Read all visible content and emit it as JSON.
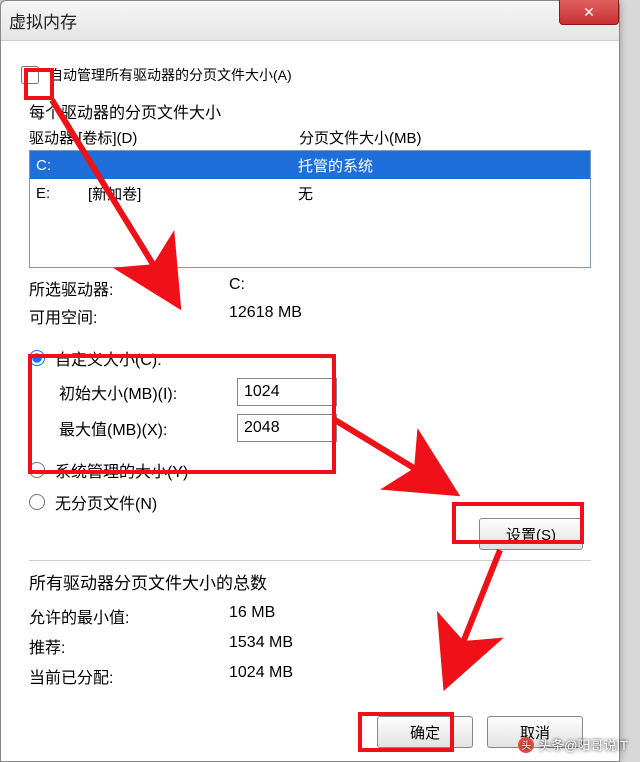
{
  "window": {
    "title": "虚拟内存"
  },
  "auto_manage": {
    "label": "自动管理所有驱动器的分页文件大小(A)",
    "checked": false
  },
  "per_drive_label": "每个驱动器的分页文件大小",
  "col_drive": "驱动器 [卷标](D)",
  "col_paging": "分页文件大小(MB)",
  "drives": [
    {
      "letter": "C:",
      "label": "",
      "paging": "托管的系统",
      "selected": true
    },
    {
      "letter": "E:",
      "label": "[新加卷]",
      "paging": "无",
      "selected": false
    }
  ],
  "selected_drive": {
    "label": "所选驱动器:",
    "value": "C:"
  },
  "free_space": {
    "label": "可用空间:",
    "value": "12618 MB"
  },
  "custom": {
    "label": "自定义大小(C):",
    "checked": true
  },
  "initial": {
    "label": "初始大小(MB)(I):",
    "value": "1024"
  },
  "max": {
    "label": "最大值(MB)(X):",
    "value": "2048"
  },
  "system_managed": {
    "label": "系统管理的大小(Y)"
  },
  "no_paging": {
    "label": "无分页文件(N)"
  },
  "set_btn": "设置(S)",
  "totals_label": "所有驱动器分页文件大小的总数",
  "min_allowed": {
    "label": "允许的最小值:",
    "value": "16 MB"
  },
  "recommended": {
    "label": "推荐:",
    "value": "1534 MB"
  },
  "current": {
    "label": "当前已分配:",
    "value": "1024 MB"
  },
  "ok_btn": "确定",
  "cancel_btn": "取消",
  "watermark": "头条@阳哥说IT"
}
